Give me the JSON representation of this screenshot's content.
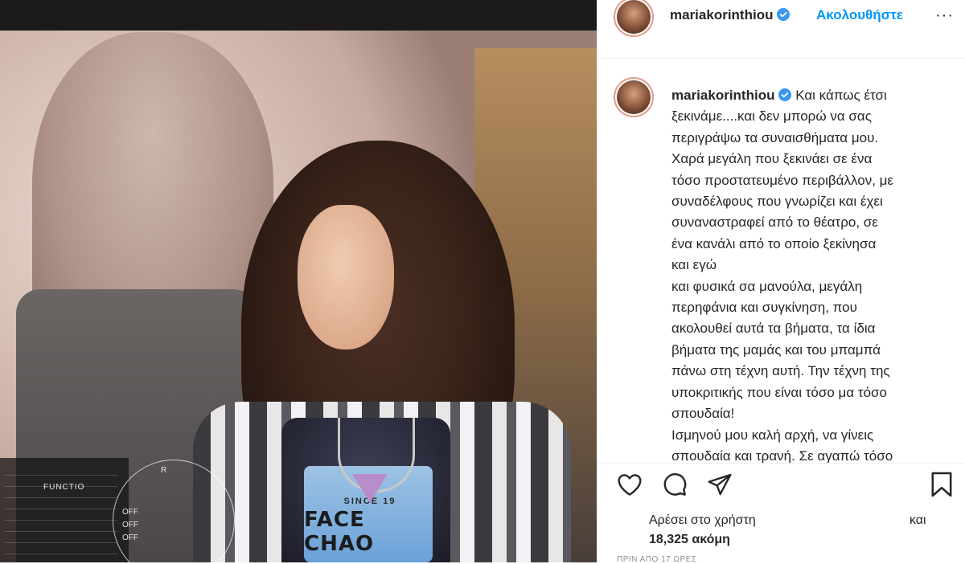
{
  "post": {
    "image_alt": "Girl on set seen through a camera monitor",
    "tee_text": "FACE CHAO",
    "tee_sub": "SINCE 19",
    "monitor": {
      "scope_label": "FUNCTIO",
      "hud_items": [
        "OFF",
        "OFF",
        "OFF"
      ],
      "hud_r": "R"
    }
  },
  "header": {
    "username": "mariakorinthiou",
    "follow_label": "Ακολουθήστε",
    "more_label": "···"
  },
  "caption": {
    "username": "mariakorinthiou",
    "text": "Και κάπως έτσι\nξεκινάμε....και δεν μπορώ να σας\nπεριγράψω τα συναισθήματα μου.\nΧαρά μεγάλη που ξεκινάει σε ένα\nτόσο προστατευμένο περιβάλλον, με\nσυναδέλφους που γνωρίζει και έχει\nσυναναστραφεί από το θέατρο, σε\nένα κανάλι από το οποίο ξεκίνησα\nκαι εγώ\nκαι φυσικά σα μανούλα, μεγάλη\nπερηφάνια και συγκίνηση, που\nακολουθεί αυτά τα βήματα, τα ίδια\nβήματα της μαμάς και του μπαμπά\nπάνω στη τέχνη αυτή. Την τέχνη της\nυποκριτικής που είναι τόσο μα τόσο\nσπουδαία!\nΙσμηνού μου καλή αρχή, να γίνεις\nσπουδαία και τρανή. Σε αγαπώ τόσο\nπολύ, πάντα και πάντα δίπλα σου!"
  },
  "actions": {
    "like_icon": "heart-icon",
    "comment_icon": "comment-icon",
    "share_icon": "share-icon",
    "save_icon": "bookmark-icon"
  },
  "likes": {
    "liked_by_text": "Αρέσει στο χρήστη",
    "and_text": "και",
    "others_count": "18,325 ακόμη"
  },
  "timestamp": "ΠΡΙΝ ΑΠΟ 17 ΩΡΕΣ",
  "colors": {
    "accent": "#0095f6",
    "text": "#262626",
    "muted": "#8e8e8e",
    "border": "#efefef"
  }
}
